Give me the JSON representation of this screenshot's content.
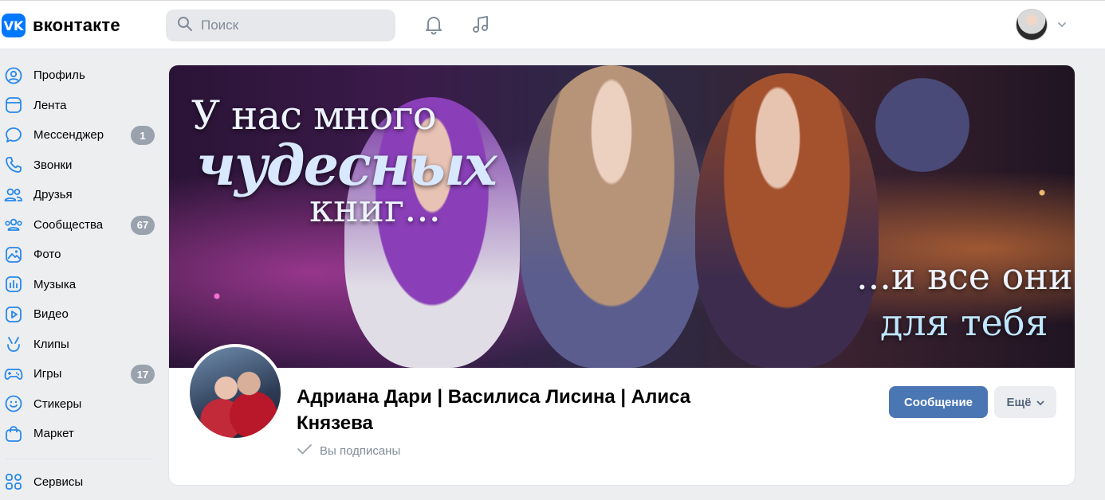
{
  "header": {
    "logo_mark": "VK",
    "logo_text": "вконтакте",
    "search_placeholder": "Поиск",
    "icons": [
      "bell-icon",
      "music-note-icon",
      "chevron-down-icon"
    ]
  },
  "sidebar": {
    "items": [
      {
        "label": "Профиль",
        "icon": "user-icon"
      },
      {
        "label": "Лента",
        "icon": "news-icon"
      },
      {
        "label": "Мессенджер",
        "icon": "message-icon",
        "badge": "1"
      },
      {
        "label": "Звонки",
        "icon": "phone-icon"
      },
      {
        "label": "Друзья",
        "icon": "friends-icon"
      },
      {
        "label": "Сообщества",
        "icon": "communities-icon",
        "badge": "67"
      },
      {
        "label": "Фото",
        "icon": "photo-icon"
      },
      {
        "label": "Музыка",
        "icon": "music-icon"
      },
      {
        "label": "Видео",
        "icon": "video-icon"
      },
      {
        "label": "Клипы",
        "icon": "clips-icon"
      },
      {
        "label": "Игры",
        "icon": "games-icon",
        "badge": "17"
      },
      {
        "label": "Стикеры",
        "icon": "sticker-icon"
      },
      {
        "label": "Маркет",
        "icon": "market-icon"
      }
    ],
    "services": {
      "label": "Сервисы",
      "icon": "services-icon"
    }
  },
  "cover": {
    "line1": "У нас много",
    "line2": "чудесных",
    "line3": "книг...",
    "line4": "...и все они",
    "line5": "для тебя"
  },
  "profile": {
    "name": "Адриана Дари | Василиса Лисина | Алиса Князева",
    "subscribed": "Вы подписаны",
    "message_button": "Сообщение",
    "more_button": "Ещё"
  },
  "colors": {
    "accent": "#0077ff",
    "primary_button": "#4a76b4",
    "badge": "#99a2ad",
    "icon": "#2688eb"
  }
}
